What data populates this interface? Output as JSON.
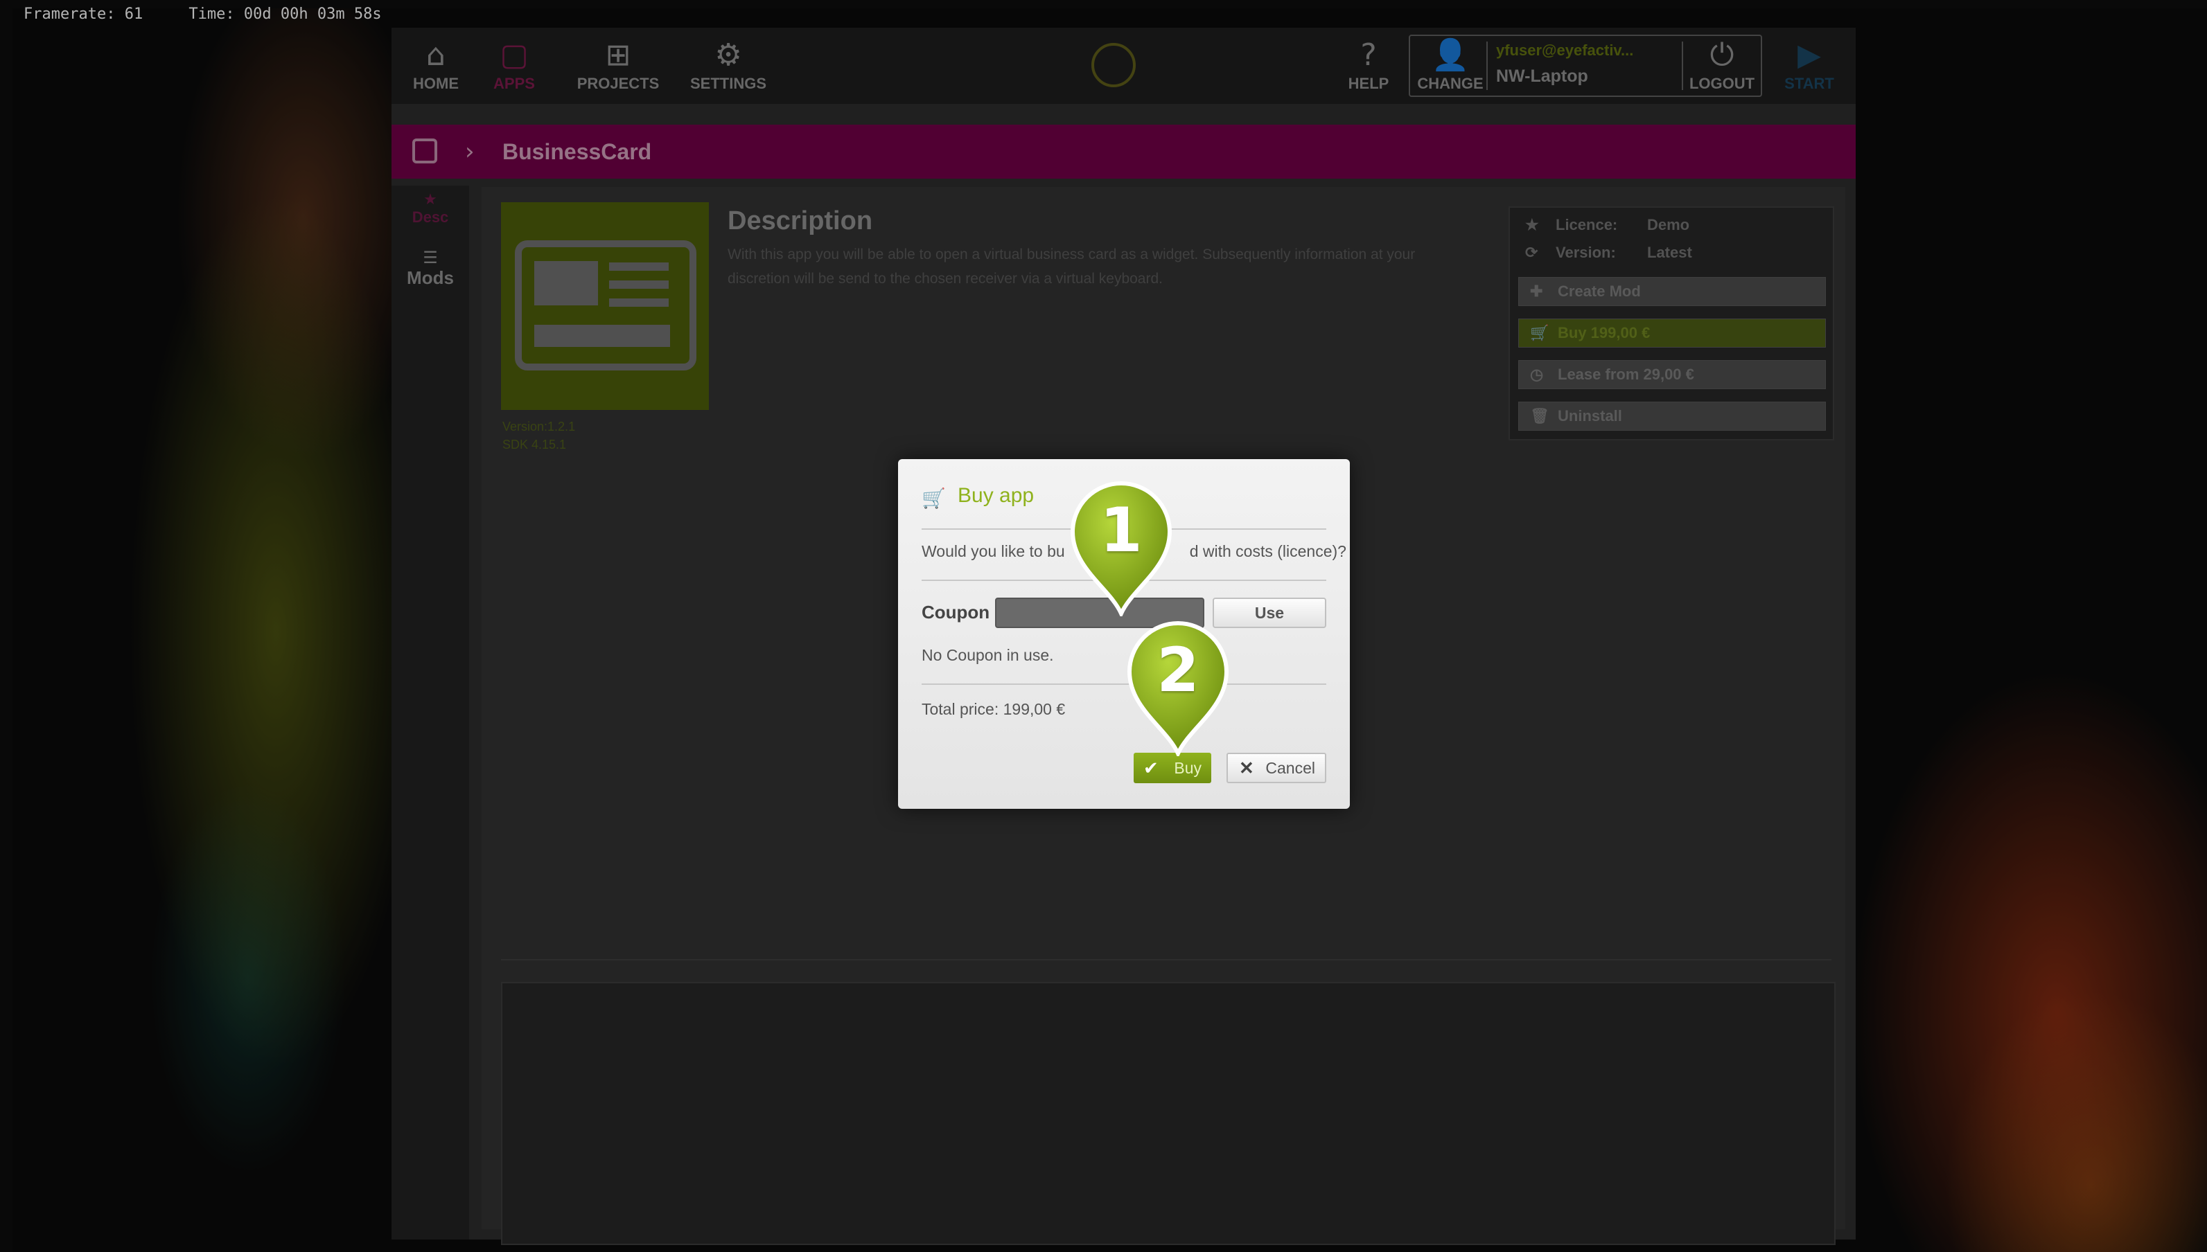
{
  "overlay": {
    "framerate_label": "Framerate: 61",
    "time_label": "Time: 00d 00h 03m 58s"
  },
  "topbar": {
    "nav": [
      {
        "label": "HOME",
        "icon": "home-icon"
      },
      {
        "label": "APPS",
        "icon": "apps-icon"
      },
      {
        "label": "PROJECTS",
        "icon": "projects-icon"
      },
      {
        "label": "SETTINGS",
        "icon": "gear-icon"
      }
    ],
    "help_label": "HELP",
    "change_label": "CHANGE",
    "user_email": "yfuser@eyefactiv...",
    "device_name": "NW-Laptop",
    "logout_label": "LOGOUT",
    "start_label": "START"
  },
  "titlebar": {
    "title": "BusinessCard"
  },
  "sidebar": {
    "items": [
      {
        "label": "Desc"
      },
      {
        "label": "Mods"
      }
    ]
  },
  "app_detail": {
    "description_title": "Description",
    "description_text": "With this app you will be able to open a virtual business card as a widget. Subsequently information at your discretion will be send to the chosen receiver via a virtual keyboard.",
    "version": "Version:1.2.1",
    "sdk": "SDK 4.15.1",
    "licence_label": "Licence:",
    "licence_value": "Demo",
    "version_label": "Version:",
    "version_value": "Latest",
    "buttons": {
      "create_mod": "Create Mod",
      "buy": "Buy 199,00 €",
      "lease": "Lease from 29,00 €",
      "uninstall": "Uninstall"
    }
  },
  "dialog": {
    "title": "Buy app",
    "question_left": "Would you like to bu",
    "question_right": "d with costs (licence)?",
    "coupon_label": "Coupon",
    "coupon_value": "",
    "use_label": "Use",
    "coupon_status": "No Coupon in use.",
    "total": "Total price: 199,00 €",
    "buy_label": "Buy",
    "cancel_label": "Cancel"
  },
  "markers": [
    {
      "number": "1"
    },
    {
      "number": "2"
    }
  ],
  "colors": {
    "accent_green": "#8fb21d",
    "title_magenta": "#6d0044",
    "apps_pink": "#a0206a"
  }
}
